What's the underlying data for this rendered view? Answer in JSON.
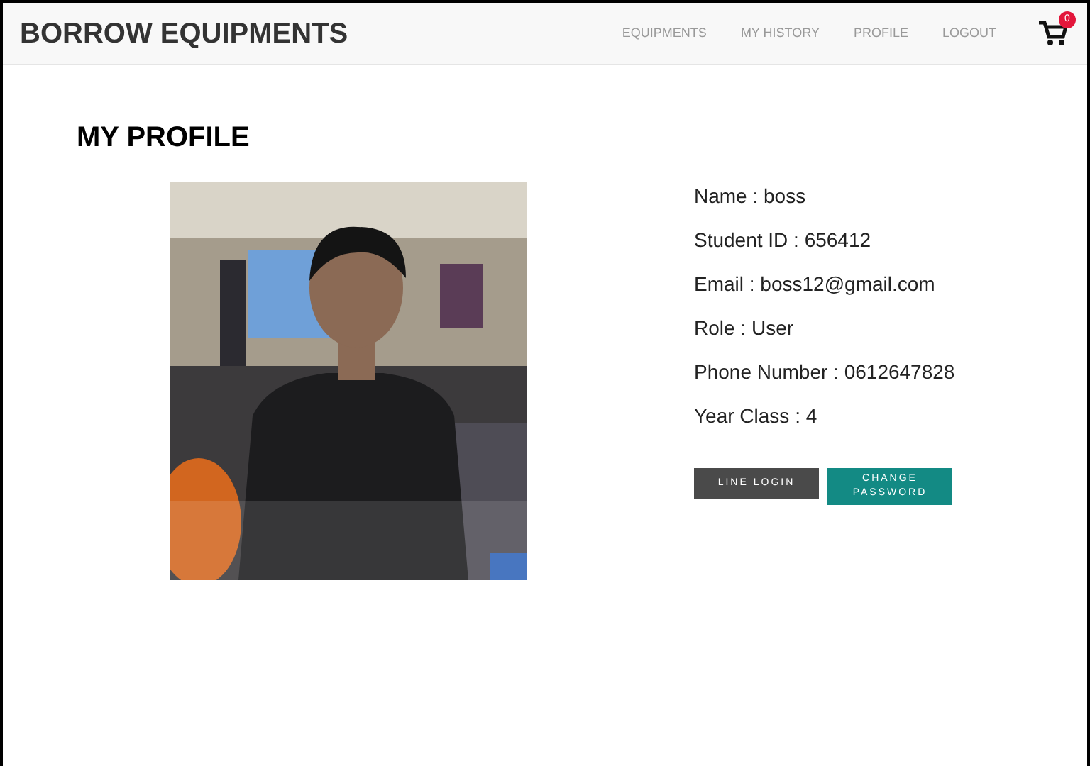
{
  "brand": "BORROW EQUIPMENTS",
  "nav": [
    {
      "label": "EQUIPMENTS"
    },
    {
      "label": "MY HISTORY"
    },
    {
      "label": "PROFILE"
    },
    {
      "label": "LOGOUT"
    }
  ],
  "cart": {
    "count": "0"
  },
  "page_title": "MY PROFILE",
  "fields": [
    "Name : boss",
    "Student ID : 656412",
    "Email : boss12@gmail.com",
    "Role : User",
    "Phone Number : 0612647828",
    "Year Class : 4"
  ],
  "buttons": [
    {
      "label": "LINE LOGIN",
      "kind": "dark"
    },
    {
      "label": "CHANGE PASSWORD",
      "kind": "teal"
    }
  ]
}
